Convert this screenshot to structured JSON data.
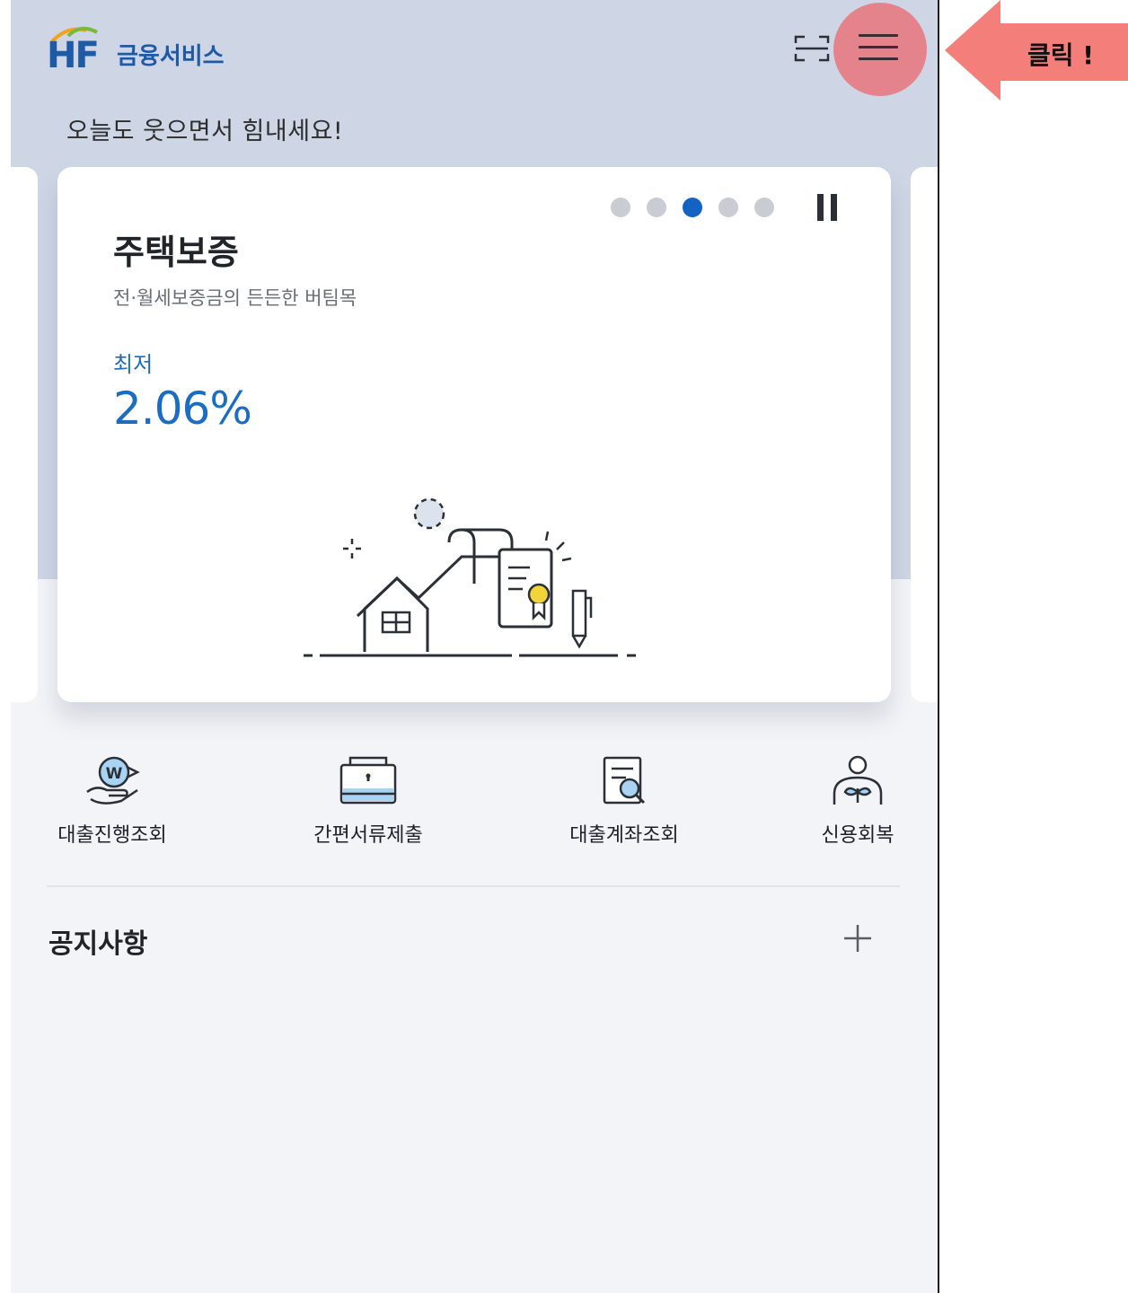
{
  "header": {
    "logo_mark": "HF",
    "logo_name": "금융서비스",
    "greeting": "오늘도 웃으면서 힘내세요!"
  },
  "banner": {
    "title": "주택보증",
    "subtitle": "전·월세보증금의 든든한 버팀목",
    "rate_label": "최저",
    "rate_value": "2.06%",
    "slides_total": 5,
    "active_slide": 3
  },
  "quick_menu": [
    {
      "label": "대출진행조회",
      "icon": "loan-progress-icon"
    },
    {
      "label": "간편서류제출",
      "icon": "document-submit-icon"
    },
    {
      "label": "대출계좌조회",
      "icon": "loan-account-icon"
    },
    {
      "label": "신용회복",
      "icon": "credit-recovery-icon"
    }
  ],
  "notice": {
    "title": "공지사항",
    "more_icon": "plus-icon"
  },
  "annotation": {
    "label": "클릭 !",
    "color": "#f47f7a"
  },
  "colors": {
    "brand_blue": "#1f5aa6",
    "rate_blue": "#1a6dc1",
    "highlight": "#e4838b",
    "header_bg": "#ced6e6"
  }
}
